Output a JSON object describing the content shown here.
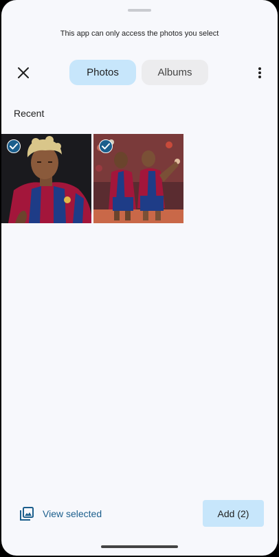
{
  "notice": "This app can only access the photos you select",
  "header": {
    "tabs": [
      {
        "label": "Photos",
        "selected": true
      },
      {
        "label": "Albums",
        "selected": false
      }
    ]
  },
  "section": {
    "title": "Recent"
  },
  "photos": [
    {
      "selected": true
    },
    {
      "selected": true
    }
  ],
  "footer": {
    "view_selected_label": "View selected",
    "add_label": "Add (2)"
  },
  "colors": {
    "accent": "#1b5e8c",
    "tab_selected_bg": "#c7e6fb",
    "tab_unselected_bg": "#ececee",
    "sheet_bg": "#f7f8fc"
  },
  "icons": [
    "close-icon",
    "more-vert-icon",
    "check-icon",
    "photo-library-icon"
  ]
}
